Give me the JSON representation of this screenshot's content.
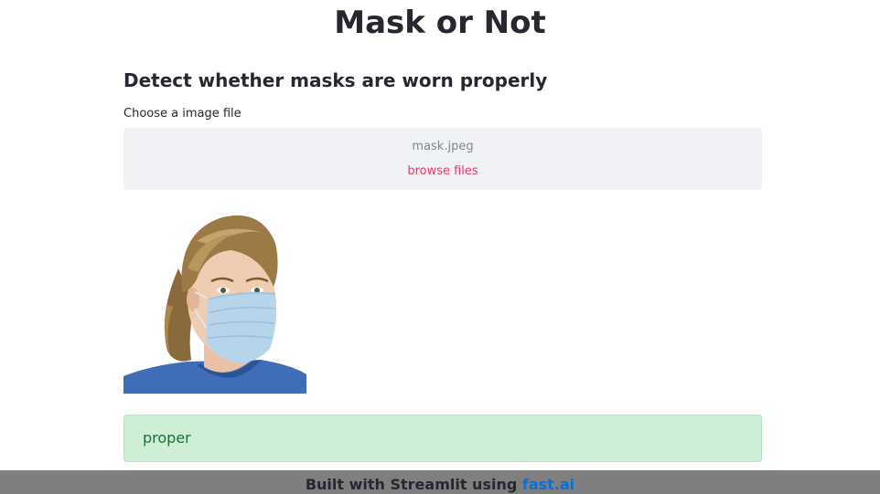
{
  "app": {
    "title": "Mask or Not"
  },
  "main": {
    "subheader": "Detect whether masks are worn properly",
    "uploader": {
      "label": "Choose a image file",
      "file_name": "mask.jpeg",
      "browse_label": "browse files"
    },
    "image": {
      "alt": "uploaded photo of a woman wearing a surgical mask"
    },
    "result": {
      "text": "proper",
      "status": "success",
      "background_color": "#cfeed6",
      "text_color": "#1e6e38"
    }
  },
  "footer": {
    "prefix": "Built with Streamlit using ",
    "link_text": "fast.ai",
    "background_color": "#7f7f7f",
    "link_color": "#0a6fd6"
  },
  "colors": {
    "accent": "#f63366",
    "dropzone_bg": "#f0f2f6",
    "text": "#262730"
  }
}
